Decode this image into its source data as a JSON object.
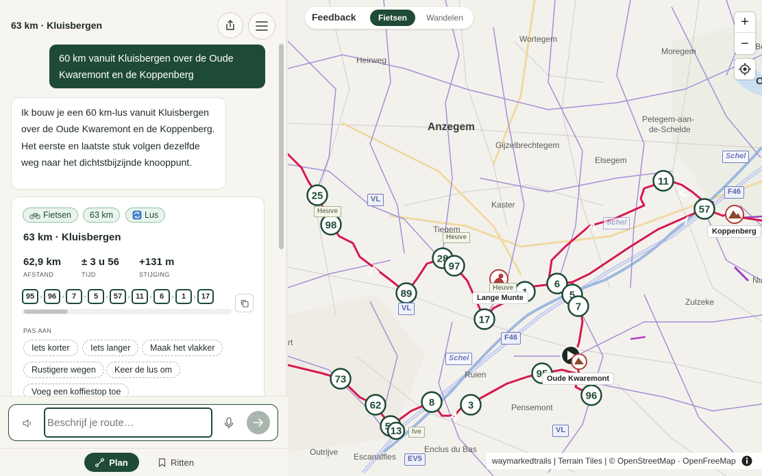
{
  "header": {
    "title": "63 km · Kluisbergen"
  },
  "chat": {
    "user_message": "60 km vanuit Kluisbergen over de Oude Kwaremont en de Koppenberg",
    "assistant_message": "Ik bouw je een 60 km-lus vanuit Kluisbergen over de Oude Kwaremont en de Koppenberg. Het eerste en laatste stuk volgen dezelfde weg naar het dichtstbijzijnde knooppunt."
  },
  "route_card": {
    "tags": [
      "Fietsen",
      "63 km",
      "Lus"
    ],
    "title": "63 km · Kluisbergen",
    "stats": [
      {
        "value": "62,9 km",
        "label": "AFSTAND"
      },
      {
        "value": "± 3 u 56",
        "label": "TIJD"
      },
      {
        "value": "+131 m",
        "label": "STIJGING"
      }
    ],
    "nodes": [
      "95",
      "96",
      "7",
      "5",
      "57",
      "11",
      "6",
      "1",
      "17"
    ],
    "adjust_label": "PAS AAN",
    "suggestions": [
      "Iets korter",
      "Iets langer",
      "Maak het vlakker",
      "Rustigere wegen",
      "Keer de lus om",
      "Voeg een koffiestop toe"
    ]
  },
  "input": {
    "placeholder": "Beschrijf je route…",
    "value": ""
  },
  "bottom_nav": {
    "plan": "Plan",
    "ritten": "Ritten"
  },
  "map": {
    "feedback": "Feedback",
    "modes": [
      "Fietsen",
      "Wandelen"
    ],
    "active_mode": "Fietsen",
    "zoom_in": "+",
    "zoom_out": "−",
    "attribution": "waymarkedtrails | Terrain Tiles | © OpenStreetMap · OpenFreeMap",
    "towns": [
      {
        "name": "Wortegem"
      },
      {
        "name": "Heirweg"
      },
      {
        "name": "Moregem"
      },
      {
        "name": "Anzegem"
      },
      {
        "name": "Gijzelbrechtegem"
      },
      {
        "name": "Petegem-aan-"
      },
      {
        "name": "de-Schelde"
      },
      {
        "name": "Elsegem"
      },
      {
        "name": "Kaster"
      },
      {
        "name": "Tiegem"
      },
      {
        "name": "Zulzeke"
      },
      {
        "name": "Ruien"
      },
      {
        "name": "Pensemont"
      },
      {
        "name": "Outrijve"
      },
      {
        "name": "Escanaffles"
      },
      {
        "name": "Enclus du Bas"
      },
      {
        "name": "Be"
      },
      {
        "name": "Nu"
      },
      {
        "name": "O"
      },
      {
        "name": "rt"
      }
    ],
    "pois": [
      "Lange Munte",
      "Koppenberg",
      "Oude Kwaremont"
    ],
    "road_shields": [
      "VL",
      "VL",
      "F46",
      "F46",
      "VL",
      "EV5"
    ],
    "water_shields": [
      "Schel",
      "Schel",
      "Schel"
    ],
    "green_shields": [
      "Heuve",
      "Heuve",
      "Heuve",
      "lve"
    ],
    "markers": [
      "25",
      "98",
      "28",
      "97",
      "89",
      "17",
      "1",
      "6",
      "5",
      "7",
      "11",
      "57",
      "95",
      "96",
      "73",
      "62",
      "59",
      "13",
      "8",
      "3"
    ],
    "colors": {
      "route": "#d6184f",
      "marker": "#1e4a36",
      "cycle_network": "#a58fd6"
    }
  }
}
